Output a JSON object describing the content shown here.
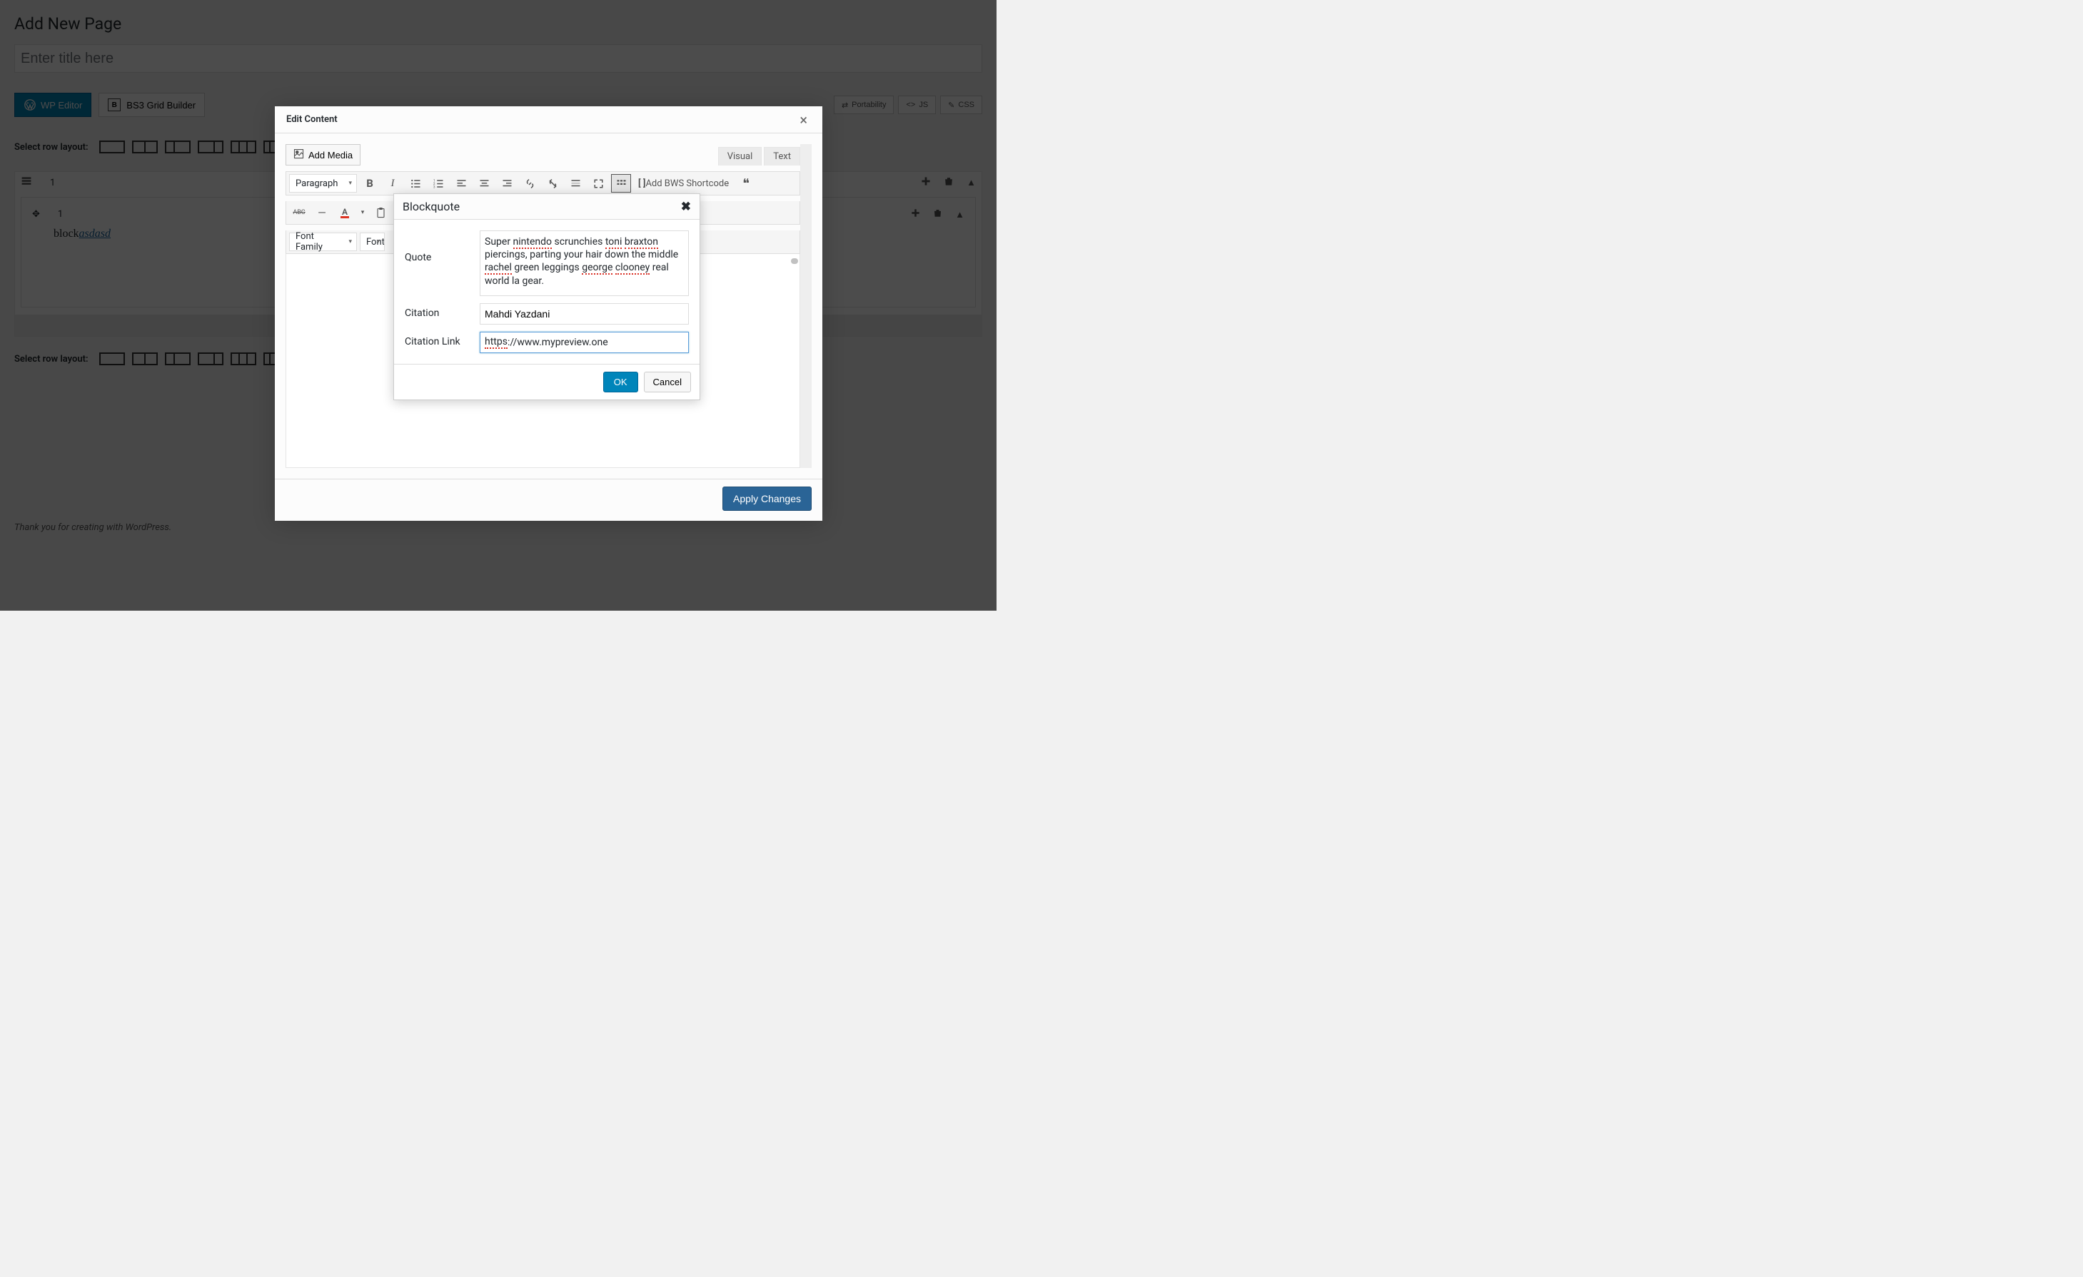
{
  "page": {
    "heading": "Add New Page",
    "title_placeholder": "Enter title here"
  },
  "buttons": {
    "wp_editor": "WP Editor",
    "bs3": "BS3 Grid Builder",
    "portability": "Portability",
    "js": "JS",
    "css": "CSS"
  },
  "row_layout": {
    "label": "Select row layout:"
  },
  "block_row": {
    "index1": "1",
    "index1b": "1",
    "text_block": "block",
    "text_asd": "asdasd"
  },
  "edit_modal": {
    "title": "Edit Content",
    "add_media": "Add Media",
    "tab_visual": "Visual",
    "tab_text": "Text",
    "paragraph": "Paragraph",
    "font_family": "Font Family",
    "font_partial": "Font",
    "bws": "Add BWS Shortcode",
    "apply": "Apply Changes",
    "abc": "ABC"
  },
  "bq": {
    "title": "Blockquote",
    "quote_label": "Quote",
    "citation_label": "Citation",
    "link_label": "Citation Link",
    "quote_p1": "Super ",
    "quote_s1": "nintendo",
    "quote_p2": " scrunchies ",
    "quote_s2": "toni",
    "quote_sp": " ",
    "quote_s3": "braxton",
    "quote_p3": " piercings, parting your hair down the middle ",
    "quote_s4": "rachel",
    "quote_p4": " green leggings ",
    "quote_s5": "george",
    "quote_sp2": " ",
    "quote_s6": "clooney",
    "quote_p5": " real world la gear.",
    "citation": "Mahdi Yazdani",
    "link_s1": "https",
    "link_p2": "://www.mypreview.one",
    "ok": "OK",
    "cancel": "Cancel"
  },
  "footer": {
    "credit": "Thank you for creating with WordPress."
  }
}
